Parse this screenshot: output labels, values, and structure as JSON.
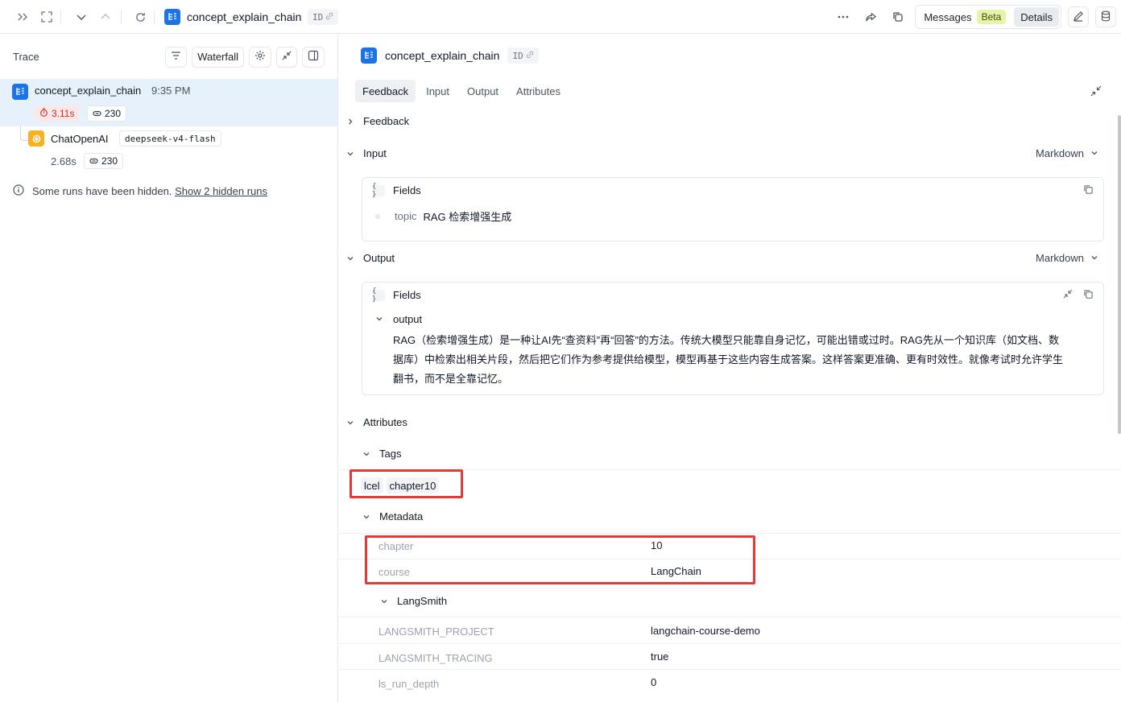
{
  "header": {
    "title": "concept_explain_chain",
    "id_label": "ID",
    "messages_label": "Messages",
    "beta_label": "Beta",
    "details_label": "Details"
  },
  "trace": {
    "title": "Trace",
    "view_mode": "Waterfall",
    "runs": [
      {
        "name": "concept_explain_chain",
        "time": "9:35 PM",
        "latency": "3.11s",
        "tokens": "230"
      },
      {
        "name": "ChatOpenAI",
        "model": "deepseek-v4-flash",
        "latency": "2.68s",
        "tokens": "230"
      }
    ],
    "hidden_note": "Some runs have been hidden.",
    "hidden_link": "Show 2 hidden runs"
  },
  "detail": {
    "title": "concept_explain_chain",
    "id_label": "ID",
    "tabs": [
      "Feedback",
      "Input",
      "Output",
      "Attributes"
    ],
    "feedback_label": "Feedback",
    "input": {
      "label": "Input",
      "format": "Markdown",
      "fields_label": "Fields",
      "key": "topic",
      "value": "RAG 检索增强生成"
    },
    "output": {
      "label": "Output",
      "format": "Markdown",
      "fields_label": "Fields",
      "key": "output",
      "lines": [
        "RAG（检索增强生成）是一种让AI先“查资料”再“回答”的方法。传统大模型只能靠自身记忆，可能出错或过时。RAG先从一个知识库（如文档、数",
        "据库）中检索出相关片段，然后把它们作为参考提供给模型，模型再基于这些内容生成答案。这样答案更准确、更有时效性。就像考试时允许学生",
        "翻书，而不是全靠记忆。"
      ]
    },
    "attributes": {
      "label": "Attributes",
      "tags_label": "Tags",
      "tags": [
        "lcel",
        "chapter10"
      ],
      "metadata_label": "Metadata",
      "metadata": [
        {
          "key": "chapter",
          "value": "10"
        },
        {
          "key": "course",
          "value": "LangChain"
        }
      ],
      "langsmith_label": "LangSmith",
      "langsmith": [
        {
          "key": "LANGSMITH_PROJECT",
          "value": "langchain-course-demo"
        },
        {
          "key": "LANGSMITH_TRACING",
          "value": "true"
        },
        {
          "key": "ls_run_depth",
          "value": "0"
        }
      ]
    }
  },
  "colors": {
    "brand": "#1a73e8",
    "highlight": "#e53935",
    "selected_row": "#e7f1fc",
    "latency_alert": "#dc2626",
    "beta_badge": "#e4f5a8"
  },
  "icons": [
    "expand-panel-icon",
    "fullscreen-icon",
    "chevron-down-icon",
    "chevron-up-icon",
    "refresh-icon",
    "chain-icon",
    "link-icon",
    "more-icon",
    "share-icon",
    "copy-icon",
    "edit-icon",
    "database-icon",
    "filter-icon",
    "settings-icon",
    "collapse-icon",
    "layout-icon",
    "stopwatch-icon",
    "token-icon",
    "openai-icon",
    "info-icon",
    "chevron-right-icon",
    "minimize-icon"
  ]
}
